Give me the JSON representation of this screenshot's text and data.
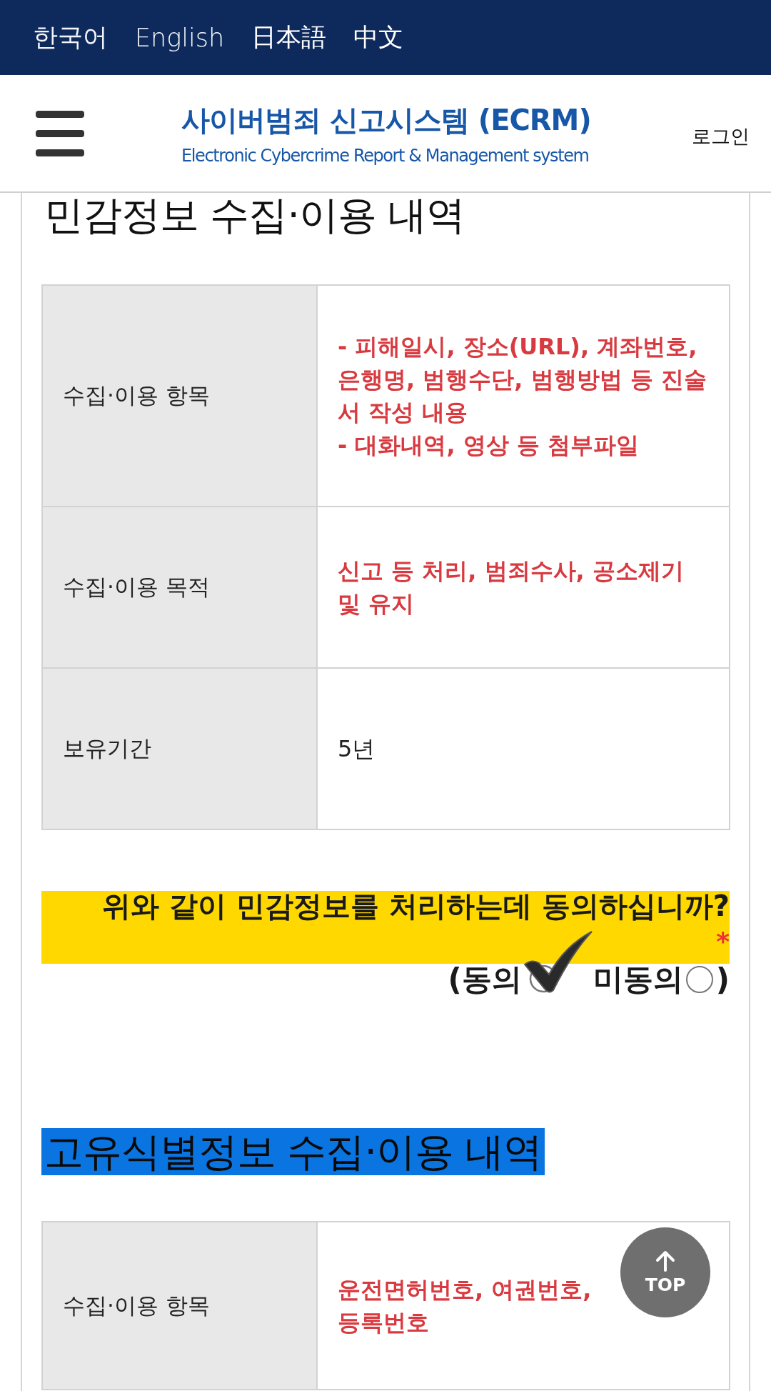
{
  "language_bar": {
    "languages": [
      {
        "label": "한국어",
        "selected": false
      },
      {
        "label": "English",
        "selected": false
      },
      {
        "label": "日本語",
        "selected": true
      },
      {
        "label": "中文",
        "selected": true
      }
    ]
  },
  "header": {
    "title": "사이버범죄 신고시스템 (ECRM)",
    "subtitle": "Electronic Cybercrime Report & Management system",
    "login": "로그인"
  },
  "sections": [
    {
      "heading": "민감정보 수집·이용 내역",
      "highlighted": false,
      "rows": [
        {
          "label": "수집·이용 항목",
          "emphasis": true,
          "lines": [
            "- 피해일시, 장소(URL), 계좌번호, 은행명, 범행수단, 범행방법 등 진술서 작성 내용",
            "- 대화내역, 영상 등 첨부파일"
          ]
        },
        {
          "label": "수집·이용 목적",
          "emphasis": true,
          "lines": [
            "신고 등 처리, 범죄수사, 공소제기 및 유지"
          ]
        },
        {
          "label": "보유기간",
          "emphasis": false,
          "lines": [
            "5년"
          ]
        }
      ],
      "consent": {
        "question": "위와 같이 민감정보를 처리하는데 동의하십니까?",
        "required_mark": "*",
        "prefix": "(",
        "suffix": ")",
        "options": [
          {
            "label": "동의",
            "selected": true
          },
          {
            "label": "미동의",
            "selected": false
          }
        ]
      }
    },
    {
      "heading": "고유식별정보 수집·이용 내역",
      "highlighted": true,
      "rows": [
        {
          "label": "수집·이용 항목",
          "emphasis": true,
          "lines": [
            "운전면허번호, 여권번호,",
            "등록번호"
          ]
        }
      ]
    }
  ],
  "top_button": {
    "label": "TOP"
  }
}
